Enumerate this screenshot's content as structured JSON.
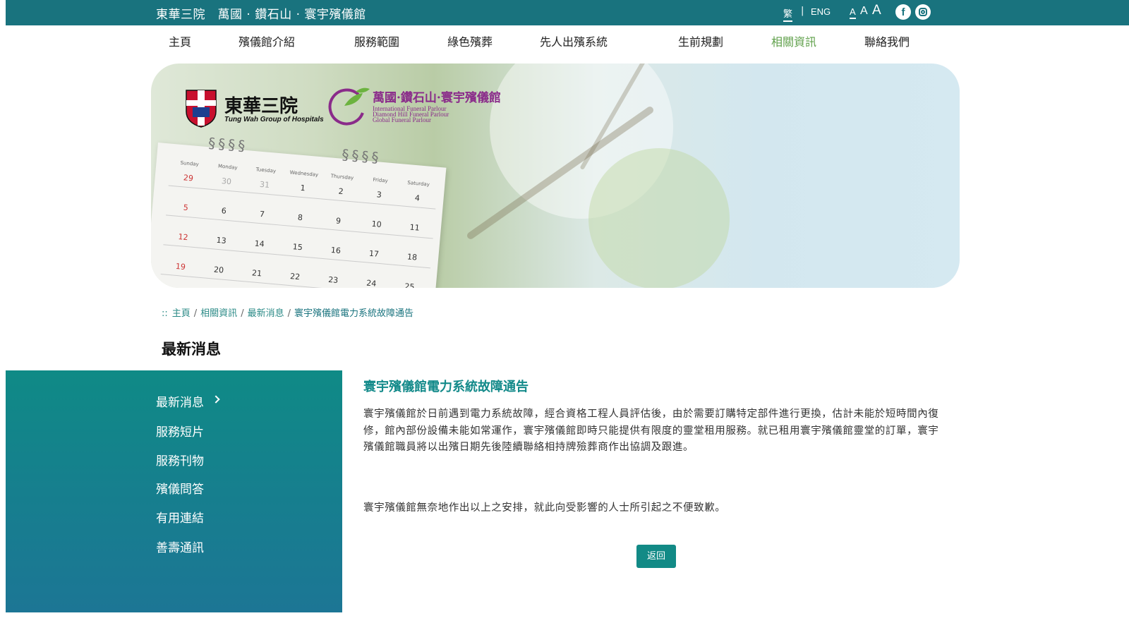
{
  "header": {
    "site_title": "東華三院　萬國 · 鑽石山 · 寰宇殯儀館",
    "lang_current": "繁",
    "lang_sep": "|",
    "lang_other": "ENG",
    "font_small": "A",
    "font_medium": "A",
    "font_large": "A",
    "facebook_icon": "facebook-icon",
    "instagram_icon": "instagram-icon"
  },
  "nav": {
    "items": [
      {
        "label": "主頁"
      },
      {
        "label": "殯儀館介紹"
      },
      {
        "label": "服務範圍"
      },
      {
        "label": "綠色殯葬"
      },
      {
        "label": "先人出殯系統"
      },
      {
        "label": "生前規劃"
      },
      {
        "label": "相關資訊",
        "active": true
      },
      {
        "label": "聯絡我們"
      }
    ]
  },
  "banner": {
    "tw_logo_cn": "東華三院",
    "tw_logo_en": "Tung Wah Group of Hospitals",
    "ff_logo_cn": "萬國·鑽石山·寰宇殯儀館",
    "ff_logo_en": [
      "International Funeral Parlour",
      "Diamond Hill Funeral Parlour",
      "Global Funeral Parlour"
    ],
    "calendar_days": [
      "Sunday",
      "Monday",
      "Tuesday",
      "Wednesday",
      "Thursday",
      "Friday",
      "Saturday"
    ],
    "calendar_dates": [
      "29",
      "30",
      "31",
      "1",
      "2",
      "3",
      "4",
      "5",
      "6",
      "7",
      "8",
      "9",
      "10",
      "11",
      "12",
      "13",
      "14",
      "15",
      "16",
      "17",
      "18",
      "19",
      "20",
      "21",
      "22",
      "23",
      "24",
      "25"
    ]
  },
  "breadcrumb": {
    "prefix": "::",
    "items": [
      "主頁",
      "相關資訊",
      "最新消息"
    ],
    "current": "寰宇殯儀館電力系統故障通告",
    "sep": "/"
  },
  "page_title": "最新消息",
  "sidebar": {
    "items": [
      {
        "label": "最新消息",
        "active": true
      },
      {
        "label": "服務短片"
      },
      {
        "label": "服務刊物"
      },
      {
        "label": "殯儀問答"
      },
      {
        "label": "有用連結"
      },
      {
        "label": "善壽通訊"
      }
    ]
  },
  "article": {
    "title": "寰宇殯儀館電力系統故障通告",
    "paragraph1": "寰宇殯儀館於日前遇到電力系統故障，經合資格工程人員評估後，由於需要訂購特定部件進行更換，估計未能於短時間內復修，館內部份設備未能如常運作，寰宇殯儀館即時只能提供有限度的靈堂租用服務。就已租用寰宇殯儀館靈堂的訂單，寰宇殯儀館職員將以出殯日期先後陸續聯絡相持牌殮葬商作出協調及跟進。",
    "paragraph2": "寰宇殯儀館無奈地作出以上之安排，就此向受影響的人士所引起之不便致歉。",
    "back_label": "返回"
  },
  "colors": {
    "brand_teal": "#19737e",
    "accent_green": "#5fa04a",
    "title_teal": "#138a8a"
  }
}
